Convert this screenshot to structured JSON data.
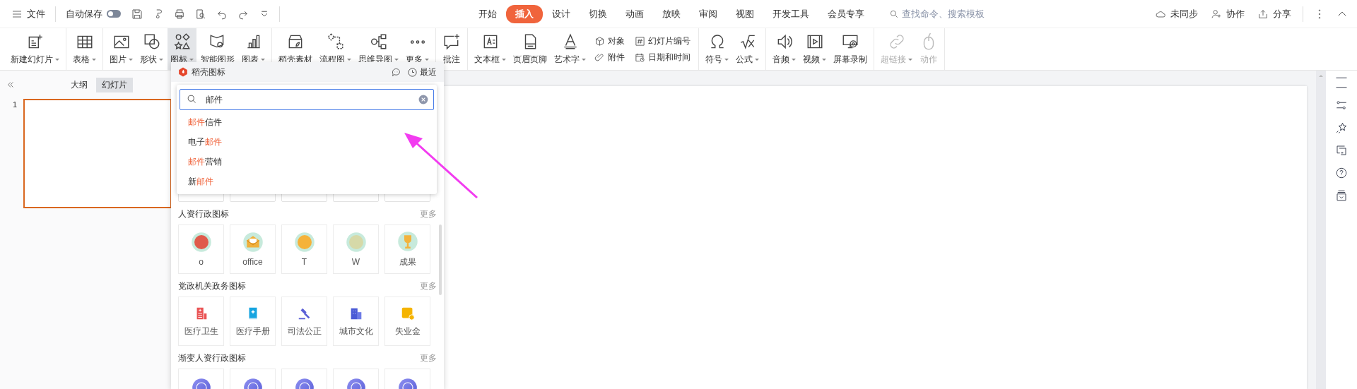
{
  "menu": {
    "label": "文件"
  },
  "autosave": {
    "label": "自动保存",
    "on": false
  },
  "tabs": [
    {
      "label": "开始",
      "selected": false
    },
    {
      "label": "插入",
      "selected": true
    },
    {
      "label": "设计",
      "selected": false
    },
    {
      "label": "切换",
      "selected": false
    },
    {
      "label": "动画",
      "selected": false
    },
    {
      "label": "放映",
      "selected": false
    },
    {
      "label": "审阅",
      "selected": false
    },
    {
      "label": "视图",
      "selected": false
    },
    {
      "label": "开发工具",
      "selected": false
    },
    {
      "label": "会员专享",
      "selected": false
    }
  ],
  "command_search": {
    "placeholder": "查找命令、搜索模板"
  },
  "account_actions": [
    {
      "label": "未同步"
    },
    {
      "label": "协作"
    },
    {
      "label": "分享"
    }
  ],
  "ribbon": {
    "groups": [
      [
        {
          "label": "新建幻灯片",
          "kind": "large",
          "dropdown": true,
          "selected": false,
          "disabled": false
        }
      ],
      [
        {
          "label": "表格",
          "kind": "large",
          "dropdown": true,
          "selected": false,
          "disabled": false
        }
      ],
      [
        {
          "label": "图片",
          "kind": "large",
          "dropdown": true,
          "selected": false,
          "disabled": false
        },
        {
          "label": "形状",
          "kind": "large",
          "dropdown": true,
          "selected": false,
          "disabled": false
        },
        {
          "label": "图标",
          "kind": "large",
          "dropdown": true,
          "selected": true,
          "disabled": false
        },
        {
          "label": "智能图形",
          "kind": "large",
          "dropdown": false,
          "selected": false,
          "disabled": false
        },
        {
          "label": "图表",
          "kind": "large",
          "dropdown": true,
          "selected": false,
          "disabled": false
        }
      ],
      [
        {
          "label": "稻壳素材",
          "kind": "large",
          "dropdown": false,
          "selected": false,
          "disabled": false
        },
        {
          "label": "流程图",
          "kind": "large",
          "dropdown": true,
          "selected": false,
          "disabled": false
        },
        {
          "label": "思维导图",
          "kind": "large",
          "dropdown": true,
          "selected": false,
          "disabled": false
        },
        {
          "label": "更多",
          "kind": "large",
          "dropdown": true,
          "selected": false,
          "disabled": false
        }
      ],
      [
        {
          "label": "批注",
          "kind": "large",
          "dropdown": false,
          "selected": false,
          "disabled": false
        }
      ],
      [
        {
          "label": "文本框",
          "kind": "large",
          "dropdown": true,
          "selected": false,
          "disabled": false
        },
        {
          "label": "页眉页脚",
          "kind": "large",
          "dropdown": false,
          "selected": false,
          "disabled": false
        },
        {
          "label": "艺术字",
          "kind": "large",
          "dropdown": true,
          "selected": false,
          "disabled": false
        },
        {
          "label": "对象",
          "kind": "small",
          "dropdown": false,
          "selected": false,
          "disabled": false
        },
        {
          "label": "附件",
          "kind": "small",
          "dropdown": false,
          "selected": false,
          "disabled": false
        },
        {
          "label": "幻灯片编号",
          "kind": "small",
          "dropdown": false,
          "selected": false,
          "disabled": false
        },
        {
          "label": "日期和时间",
          "kind": "small",
          "dropdown": false,
          "selected": false,
          "disabled": false
        }
      ],
      [
        {
          "label": "符号",
          "kind": "large",
          "dropdown": true,
          "selected": false,
          "disabled": false
        },
        {
          "label": "公式",
          "kind": "large",
          "dropdown": true,
          "selected": false,
          "disabled": false
        }
      ],
      [
        {
          "label": "音频",
          "kind": "large",
          "dropdown": true,
          "selected": false,
          "disabled": false
        },
        {
          "label": "视频",
          "kind": "large",
          "dropdown": true,
          "selected": false,
          "disabled": false
        },
        {
          "label": "屏幕录制",
          "kind": "large",
          "dropdown": false,
          "selected": false,
          "disabled": false
        }
      ],
      [
        {
          "label": "超链接",
          "kind": "large",
          "dropdown": true,
          "selected": false,
          "disabled": true
        },
        {
          "label": "动作",
          "kind": "large",
          "dropdown": false,
          "selected": false,
          "disabled": true
        }
      ]
    ]
  },
  "slide_pane": {
    "tabs": [
      {
        "label": "大纲",
        "selected": false
      },
      {
        "label": "幻灯片",
        "selected": true
      }
    ],
    "slides": [
      {
        "number": "1",
        "selected": true
      }
    ]
  },
  "icon_panel": {
    "title": "稻壳图标",
    "recent": "最近",
    "search": {
      "value": "邮件",
      "suggestions": [
        "**邮件**信件",
        "电子**邮件**",
        "**邮件**营销",
        "新**邮件**"
      ]
    },
    "sections": [
      {
        "title": "人资行政图标",
        "more": "更多",
        "items": [
          {
            "label": "o",
            "kind": "badge"
          },
          {
            "label": "office",
            "kind": "badge"
          },
          {
            "label": "T",
            "kind": "badge"
          },
          {
            "label": "W",
            "kind": "badge"
          },
          {
            "label": "成果",
            "kind": "badge"
          }
        ]
      },
      {
        "title": "党政机关政务图标",
        "more": "更多",
        "items": [
          {
            "label": "医疗卫生",
            "kind": "flat"
          },
          {
            "label": "医疗手册",
            "kind": "flat"
          },
          {
            "label": "司法公正",
            "kind": "flat"
          },
          {
            "label": "城市文化",
            "kind": "flat"
          },
          {
            "label": "失业金",
            "kind": "flat"
          }
        ]
      },
      {
        "title": "渐变人资行政图标",
        "more": "更多",
        "items": [
          {
            "kind": "gradient"
          },
          {
            "kind": "gradient"
          },
          {
            "kind": "gradient"
          },
          {
            "kind": "gradient"
          },
          {
            "kind": "gradient"
          }
        ]
      }
    ]
  }
}
